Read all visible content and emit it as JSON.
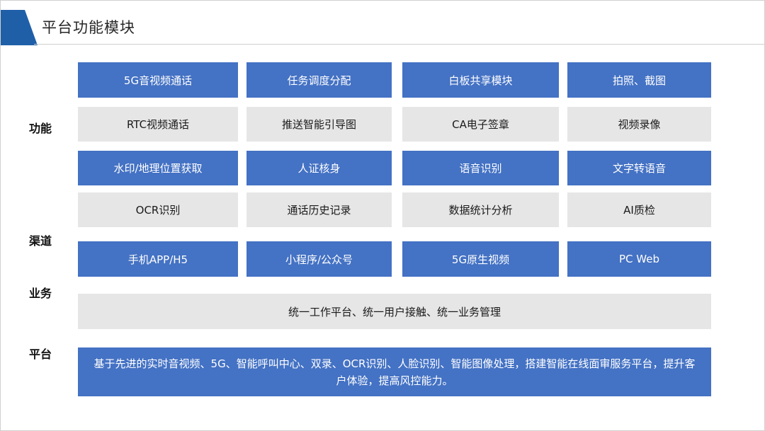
{
  "title": "平台功能模块",
  "colors": {
    "accent_blue": "#4472c4",
    "title_triangle": "#1f5fa8",
    "cell_gray": "#e6e6e6"
  },
  "side_labels": [
    "功能",
    "渠道",
    "业务",
    "平台"
  ],
  "rows": {
    "r1": [
      "5G音视频通话",
      "任务调度分配",
      "白板共享模块",
      "拍照、截图"
    ],
    "r2": [
      "RTC视频通话",
      "推送智能引导图",
      "CA电子签章",
      "视频录像"
    ],
    "r3": [
      "水印/地理位置获取",
      "人证核身",
      "语音识别",
      "文字转语音"
    ],
    "r4": [
      "OCR识别",
      "通话历史记录",
      "数据统计分析",
      "AI质检"
    ],
    "channels": [
      "手机APP/H5",
      "小程序/公众号",
      "5G原生视频",
      "PC Web"
    ]
  },
  "business": "统一工作平台、统一用户接触、统一业务管理",
  "platform": "基于先进的实时音视频、5G、智能呼叫中心、双录、OCR识别、人脸识别、智能图像处理，搭建智能在线面审服务平台，提升客户体验，提高风控能力。"
}
